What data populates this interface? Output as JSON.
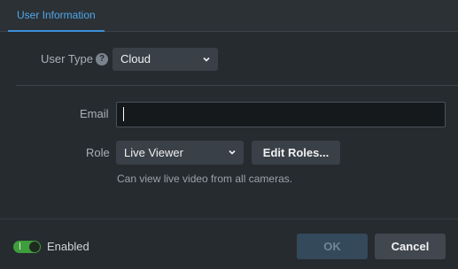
{
  "tabs": [
    {
      "label": "User Information",
      "active": true
    }
  ],
  "user_type": {
    "label": "User Type",
    "help_icon": "question-circle-icon",
    "selected": "Cloud"
  },
  "email": {
    "label": "Email",
    "value": "",
    "placeholder": ""
  },
  "role": {
    "label": "Role",
    "selected": "Live Viewer",
    "edit_button": "Edit Roles...",
    "description": "Can view live video from all cameras."
  },
  "footer": {
    "toggle_on": true,
    "enabled_label": "Enabled",
    "ok_label": "OK",
    "cancel_label": "Cancel"
  },
  "colors": {
    "accent": "#3d8fd8",
    "toggle_on": "#3e9d3c",
    "background": "#262b30"
  }
}
